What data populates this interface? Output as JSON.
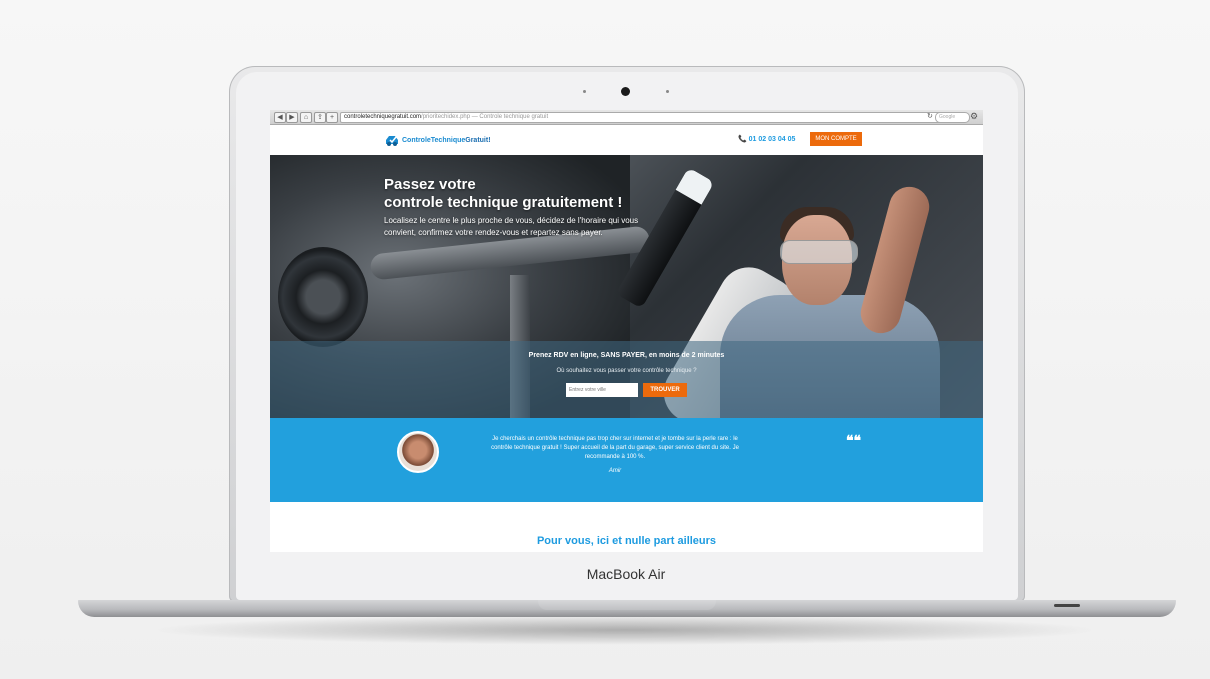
{
  "device": {
    "brand_label": "MacBook Air"
  },
  "browser": {
    "url_domain": "controletechniquegratuit.com",
    "url_rest": "/prioritechidex.php — Controle technique gratuit",
    "search_placeholder": "Google",
    "reload_icon": "reload-icon",
    "settings_icon": "gear-icon"
  },
  "header": {
    "logo_part1": "ControleTechnique",
    "logo_part2": "Gratuit!",
    "phone": "📞 01 02 03 04 05",
    "account_button": "MON COMPTE"
  },
  "hero": {
    "title_line1": "Passez votre",
    "title_line2": "controle technique gratuitement !",
    "subtitle": "Localisez le centre le plus proche de vous, décidez de l'horaire qui vous convient, confirmez votre rendez-vous et repartez sans payer.",
    "booking_title": "Prenez RDV en ligne, SANS PAYER, en moins de 2 minutes",
    "booking_question": "Où souhaitez vous passer votre contrôle technique ?",
    "city_placeholder": "Entrez votre ville",
    "find_button": "TROUVER"
  },
  "testimonial": {
    "text": "Je cherchais un contrôle technique pas trop cher sur internet et je tombe sur la perle rare : le contrôle technique gratuit ! Super accueil de la part du garage, super service client du site. Je recommande à 100 %.",
    "author": "Amir",
    "quote_mark": "❝❝"
  },
  "section": {
    "title": "Pour vous, ici et nulle part ailleurs"
  },
  "colors": {
    "accent_blue": "#22a0dd",
    "accent_orange": "#ec6a0c"
  }
}
